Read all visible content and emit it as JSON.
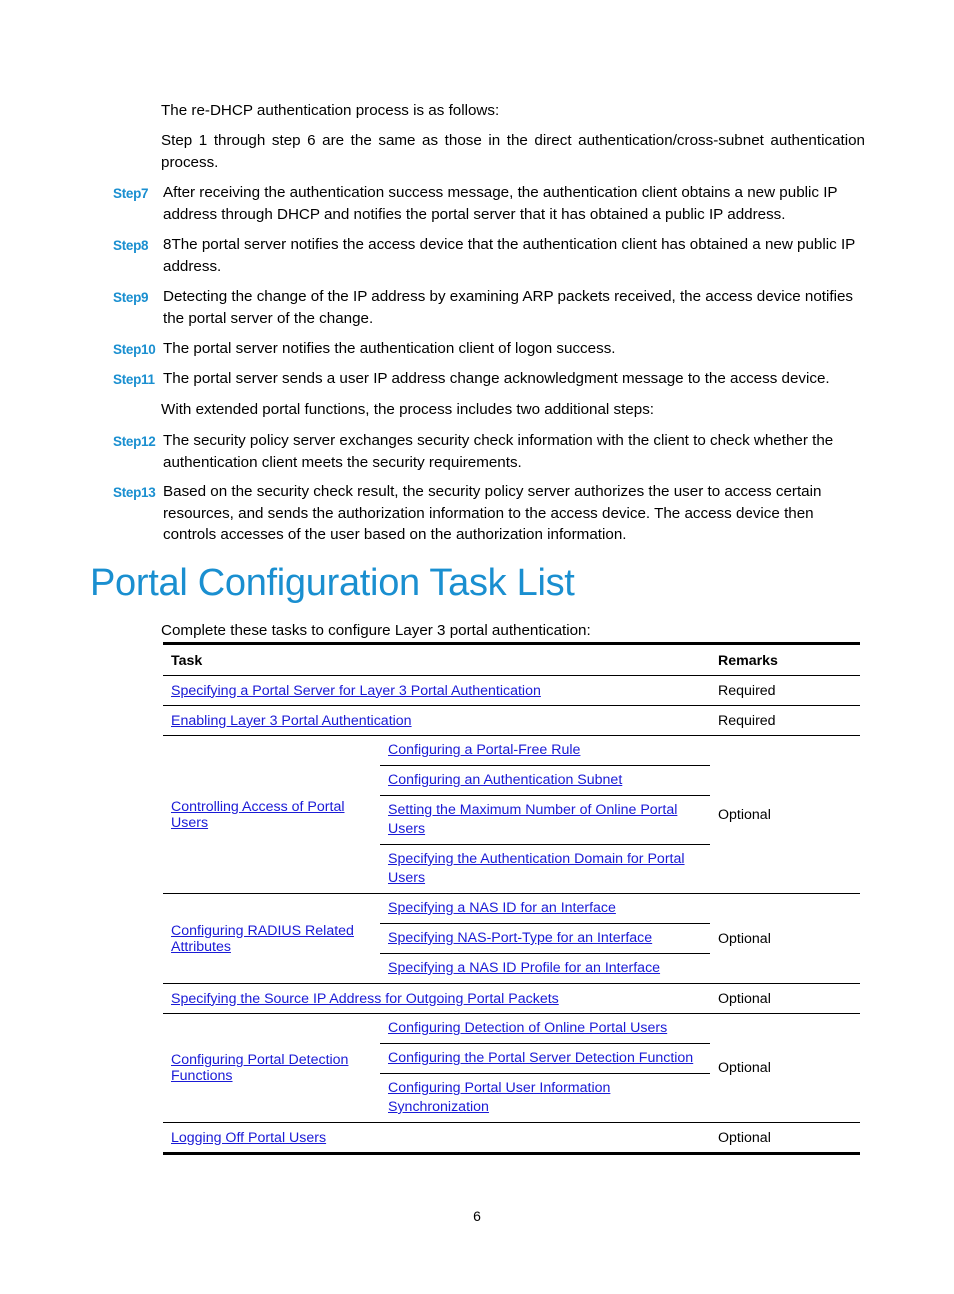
{
  "intro": {
    "line1": "The re-DHCP authentication process is as follows:",
    "line2": "Step 1 through step 6 are the same as those in the direct authentication/cross-subnet authentication process."
  },
  "steps": [
    {
      "label": "Step7",
      "text": "After receiving the authentication success message, the authentication client obtains a new public IP address through DHCP and notifies the portal server that it has obtained a public IP address."
    },
    {
      "label": "Step8",
      "text": "8The portal server notifies the access device that the authentication client has obtained a new public IP address."
    },
    {
      "label": "Step9",
      "text": "Detecting the change of the IP address by examining ARP packets received, the access device notifies the portal server of the change."
    },
    {
      "label": "Step10",
      "text": "The portal server notifies the authentication client of logon success."
    },
    {
      "label": "Step11",
      "text": "The portal server sends a user IP address change acknowledgment message to the access device."
    },
    {
      "label": "Step12",
      "text": "The security policy server exchanges security check information with the client to check whether the authentication client meets the security requirements."
    },
    {
      "label": "Step13",
      "text": "Based on the security check result, the security policy server authorizes the user to access certain resources, and sends the authorization information to the access device. The access device then controls accesses of the user based on the authorization information."
    }
  ],
  "extended_note": "With extended portal functions, the process includes two additional steps:",
  "section_title": "Portal Configuration Task List",
  "table_intro": "Complete these tasks to configure Layer 3 portal authentication:",
  "table": {
    "headers": {
      "task": "Task",
      "remarks": "Remarks"
    },
    "rows": [
      {
        "task": "Specifying a Portal Server for Layer 3 Portal Authentication",
        "remarks": "Required"
      },
      {
        "task": "Enabling Layer 3 Portal Authentication",
        "remarks": "Required"
      },
      {
        "task": "Controlling Access of Portal Users",
        "remarks": "Optional",
        "subtasks": [
          "Configuring a Portal-Free Rule",
          "Configuring an Authentication Subnet",
          "Setting the Maximum Number of Online Portal Users",
          "Specifying the Authentication Domain for Portal Users"
        ]
      },
      {
        "task": "Configuring RADIUS Related Attributes",
        "remarks": "Optional",
        "subtasks": [
          "Specifying a NAS ID for an Interface",
          "Specifying NAS-Port-Type for an Interface",
          "Specifying a NAS ID Profile for an Interface"
        ]
      },
      {
        "task": "Specifying the Source IP Address for Outgoing Portal Packets",
        "remarks": "Optional"
      },
      {
        "task": "Configuring Portal Detection Functions",
        "remarks": "Optional",
        "subtasks": [
          "Configuring Detection of Online Portal Users",
          "Configuring the Portal Server Detection Function",
          "Configuring Portal User Information Synchronization"
        ]
      },
      {
        "task": "Logging Off Portal Users",
        "remarks": "Optional"
      }
    ]
  },
  "page_number": "6",
  "colors": {
    "accent": "#1a8fd0",
    "link": "#1a1ad6"
  }
}
